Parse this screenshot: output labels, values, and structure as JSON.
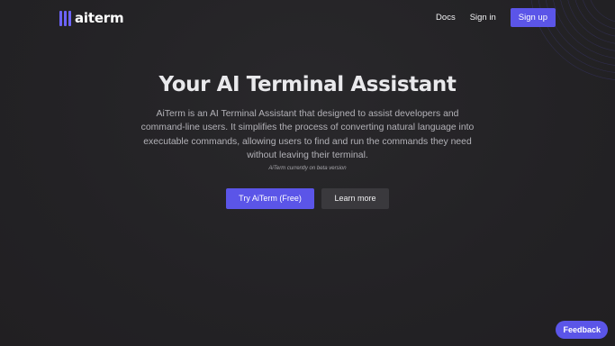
{
  "brand": {
    "name": "aiterm",
    "accent": "#5b55e8",
    "icon": "logo-bars-icon"
  },
  "nav": {
    "docs": "Docs",
    "signin": "Sign in",
    "signup": "Sign up"
  },
  "hero": {
    "title": "Your AI Terminal Assistant",
    "description": "AiTerm is an AI Terminal Assistant that designed to assist developers and command-line users. It simplifies the process of converting natural language into executable commands, allowing users to find and run the commands they need without leaving their terminal.",
    "note": "AiTerm currently on beta version"
  },
  "cta": {
    "primary": "Try AiTerm (Free)",
    "secondary": "Learn more"
  },
  "feedback": "Feedback",
  "colors": {
    "background": "#232225",
    "button_secondary": "#3a393d"
  }
}
